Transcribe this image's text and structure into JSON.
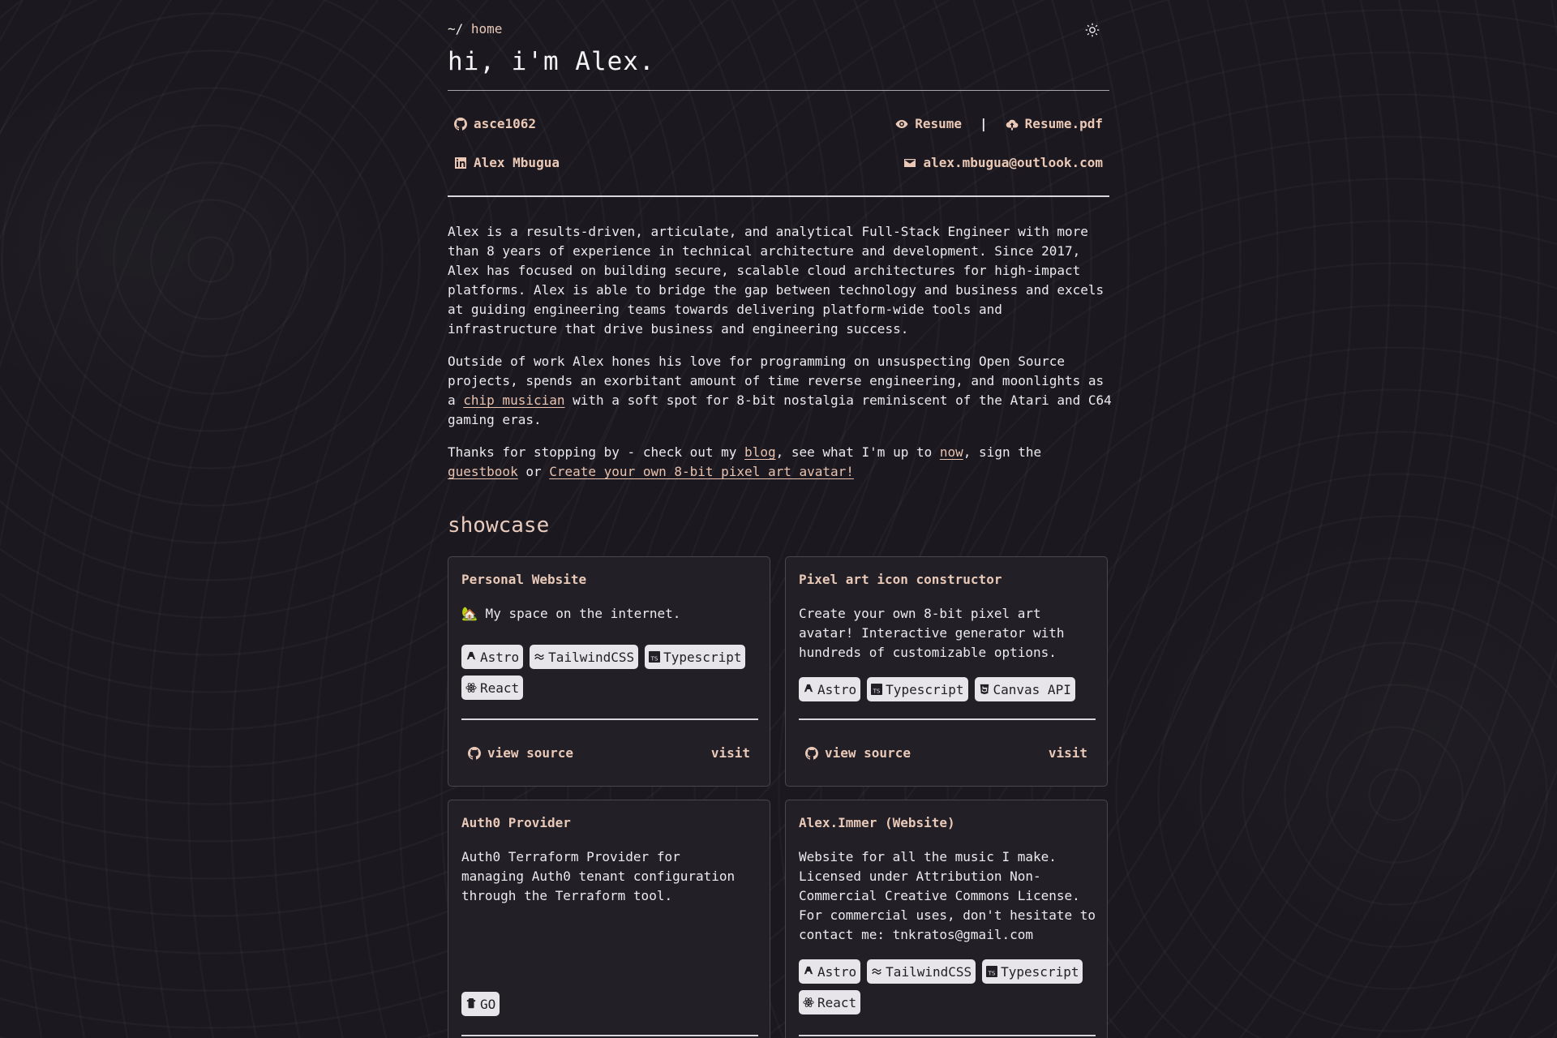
{
  "header": {
    "crumb_prefix": "~/",
    "crumb_page": "home",
    "title": "hi, i'm Alex."
  },
  "contacts": {
    "github": "asce1062",
    "linkedin": "Alex Mbugua",
    "resume": "Resume",
    "separator": "|",
    "resume_pdf": "Resume.pdf",
    "email": "alex.mbugua@outlook.com"
  },
  "bio": {
    "p1": "Alex is a results-driven, articulate, and analytical Full-Stack Engineer with more than 8 years of experience in technical architecture and development. Since 2017, Alex has focused on building secure, scalable cloud architectures for high-impact platforms. Alex is able to bridge the gap between technology and business and excels at guiding engineering teams towards delivering platform-wide tools and infrastructure that drive business and engineering success.",
    "p2_before": "Outside of work Alex hones his love for programming on unsuspecting Open Source projects, spends an exorbitant amount of time reverse engineering, and moonlights as a ",
    "p2_link": "chip musician",
    "p2_after": " with a soft spot for 8-bit nostalgia reminiscent of the Atari and C64 gaming eras.",
    "p3_a": "Thanks for stopping by - check out my ",
    "p3_blog": "blog",
    "p3_b": ", see what I'm up to ",
    "p3_now": "now",
    "p3_c": ", sign the ",
    "p3_guestbook": "guestbook",
    "p3_d": " or ",
    "p3_avatar": "Create your own 8-bit pixel art avatar!"
  },
  "showcase": {
    "heading": "showcase",
    "view_source": "view source",
    "visit": "visit",
    "cards": [
      {
        "title": "Personal Website",
        "icon": "house-emoji",
        "desc": "🏡 My space on the internet.",
        "tags": [
          "Astro",
          "TailwindCSS",
          "Typescript",
          "React"
        ]
      },
      {
        "title": "Pixel art icon constructor",
        "desc": "Create your own 8-bit pixel art avatar! Interactive generator with hundreds of customizable options.",
        "tags": [
          "Astro",
          "Typescript",
          "Canvas API"
        ]
      },
      {
        "title": "Auth0 Provider",
        "desc": "Auth0 Terraform Provider for managing Auth0 tenant configuration through the Terraform tool.",
        "tags": [
          "GO"
        ]
      },
      {
        "title": "Alex.Immer (Website)",
        "desc": "Website for all the music I make. Licensed under Attribution Non-Commercial Creative Commons License. For commercial uses, don't hesitate to contact me: tnkratos@gmail.com",
        "tags": [
          "Astro",
          "TailwindCSS",
          "Typescript",
          "React"
        ]
      }
    ]
  },
  "colors": {
    "background": "#1b191f",
    "accent": "#e9c9b8",
    "card": "#221f26",
    "tag_bg": "#e7e5ea"
  }
}
